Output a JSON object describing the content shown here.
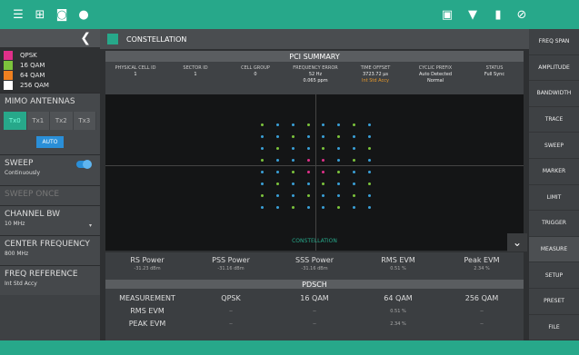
{
  "topbar": {
    "icons": [
      "menu-icon",
      "grid-icon",
      "camera-icon",
      "gps-icon",
      "battery-icon",
      "wifi-icon",
      "usb-icon",
      "settings-icon"
    ],
    "bg": "#27a88a"
  },
  "legend": [
    {
      "label": "QPSK",
      "color": "#e0308a"
    },
    {
      "label": "16 QAM",
      "color": "#7cc43c"
    },
    {
      "label": "64 QAM",
      "color": "#f08020"
    },
    {
      "label": "256 QAM",
      "color": "#ffffff"
    }
  ],
  "mimo": {
    "title": "MIMO ANTENNAS",
    "auto": "AUTO",
    "ants": [
      "Tx0",
      "Tx1",
      "Tx2",
      "Tx3"
    ]
  },
  "sweep": {
    "title": "SWEEP",
    "sub": "Continuously",
    "once": "SWEEP ONCE"
  },
  "channel_bw": {
    "title": "CHANNEL BW",
    "value": "10 MHz"
  },
  "center_freq": {
    "title": "CENTER FREQUENCY",
    "value": "800 MHz"
  },
  "freq_ref": {
    "title": "FREQ REFERENCE",
    "value": "Int Std Accy"
  },
  "main": {
    "title": "CONSTELLATION",
    "pci_title": "PCI SUMMARY",
    "pci_cols": [
      {
        "h": "PHYSICAL CELL ID",
        "v": "1",
        "v2": ""
      },
      {
        "h": "SECTOR ID",
        "v": "1",
        "v2": ""
      },
      {
        "h": "CELL GROUP",
        "v": "0",
        "v2": ""
      },
      {
        "h": "FREQUENCY ERROR",
        "v": "52 Hz",
        "v2": "0.065 ppm"
      },
      {
        "h": "TIME OFFSET",
        "v": "3723.72 µs",
        "v2": "Int Std Accy"
      },
      {
        "h": "CYCLIC PREFIX",
        "v": "Auto Detected",
        "v2": "Normal"
      },
      {
        "h": "STATUS",
        "v": "Full Sync",
        "v2": ""
      }
    ],
    "plot_label": "CONSTELLATION",
    "meas": [
      {
        "h": "RS Power",
        "v": "-31.23 dBm"
      },
      {
        "h": "PSS Power",
        "v": "-31.16 dBm"
      },
      {
        "h": "SSS Power",
        "v": "-31.16 dBm"
      },
      {
        "h": "RMS EVM",
        "v": "0.51 %"
      },
      {
        "h": "Peak EVM",
        "v": "2.34 %"
      }
    ],
    "pdsch": "PDSCH",
    "table_header": [
      "MEASUREMENT",
      "QPSK",
      "16 QAM",
      "64 QAM",
      "256 QAM"
    ],
    "table_rows": [
      [
        "RMS EVM",
        "--",
        "--",
        "0.51 %",
        "--"
      ],
      [
        "PEAK EVM",
        "--",
        "--",
        "2.34 %",
        "--"
      ]
    ]
  },
  "right_menu": [
    "FREQ SPAN",
    "AMPLITUDE",
    "BANDWIDTH",
    "TRACE",
    "SWEEP",
    "MARKER",
    "LIMIT",
    "TRIGGER",
    "MEASURE",
    "SETUP",
    "PRESET",
    "FILE"
  ]
}
